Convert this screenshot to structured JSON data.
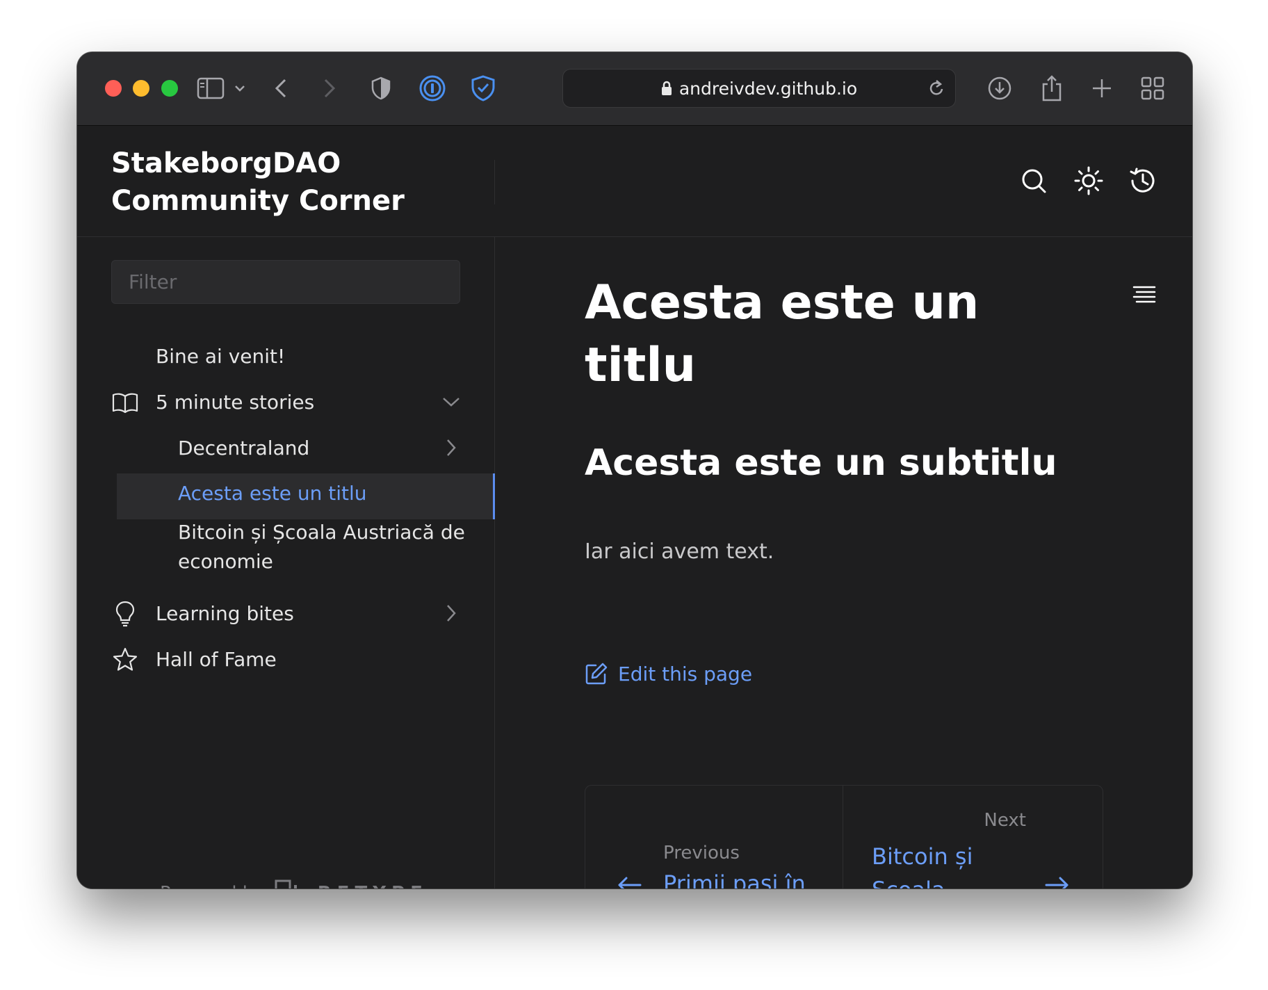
{
  "browser": {
    "url": "andreivdev.github.io"
  },
  "site": {
    "brand_line1": "StakeborgDAO",
    "brand_line2": "Community Corner"
  },
  "sidebar": {
    "filter_placeholder": "Filter",
    "items": [
      {
        "label": "Bine ai venit!"
      },
      {
        "label": "5 minute stories",
        "icon": "book-icon",
        "expanded": true
      },
      {
        "label": "Decentraland"
      },
      {
        "label": "Acesta este un titlu",
        "active": true
      },
      {
        "label": "Bitcoin și Școala Austriacă de economie"
      },
      {
        "label": "Learning bites",
        "icon": "lightbulb-icon"
      },
      {
        "label": "Hall of Fame",
        "icon": "star-icon"
      }
    ],
    "powered_by": "Powered by",
    "retype": "RETYPE"
  },
  "content": {
    "title": "Acesta este un titlu",
    "subtitle": "Acesta este un subtitlu",
    "paragraph": "Iar aici avem text.",
    "edit_link": "Edit this page",
    "pager": {
      "prev_label": "Previous",
      "prev_title": "Primii pași în",
      "next_label": "Next",
      "next_title": "Bitcoin și Școala"
    }
  },
  "colors": {
    "accent": "#6c9ef8",
    "background": "#1e1e1f",
    "toolbar": "#2c2c2e"
  }
}
